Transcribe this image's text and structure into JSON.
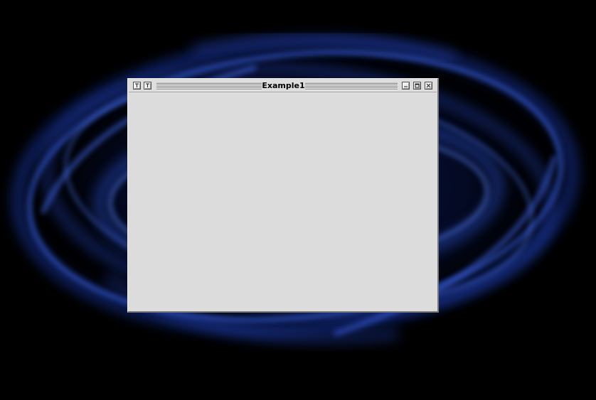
{
  "window": {
    "title": "Example1",
    "client_background": "#dcdcdc"
  },
  "titlebar": {
    "left_buttons": [
      "pin-icon",
      "shade-icon"
    ],
    "right_buttons": [
      "minimize-icon",
      "maximize-icon",
      "close-icon"
    ]
  },
  "desktop": {
    "background_color": "#000000",
    "accent_color": "#2a4fd0"
  }
}
